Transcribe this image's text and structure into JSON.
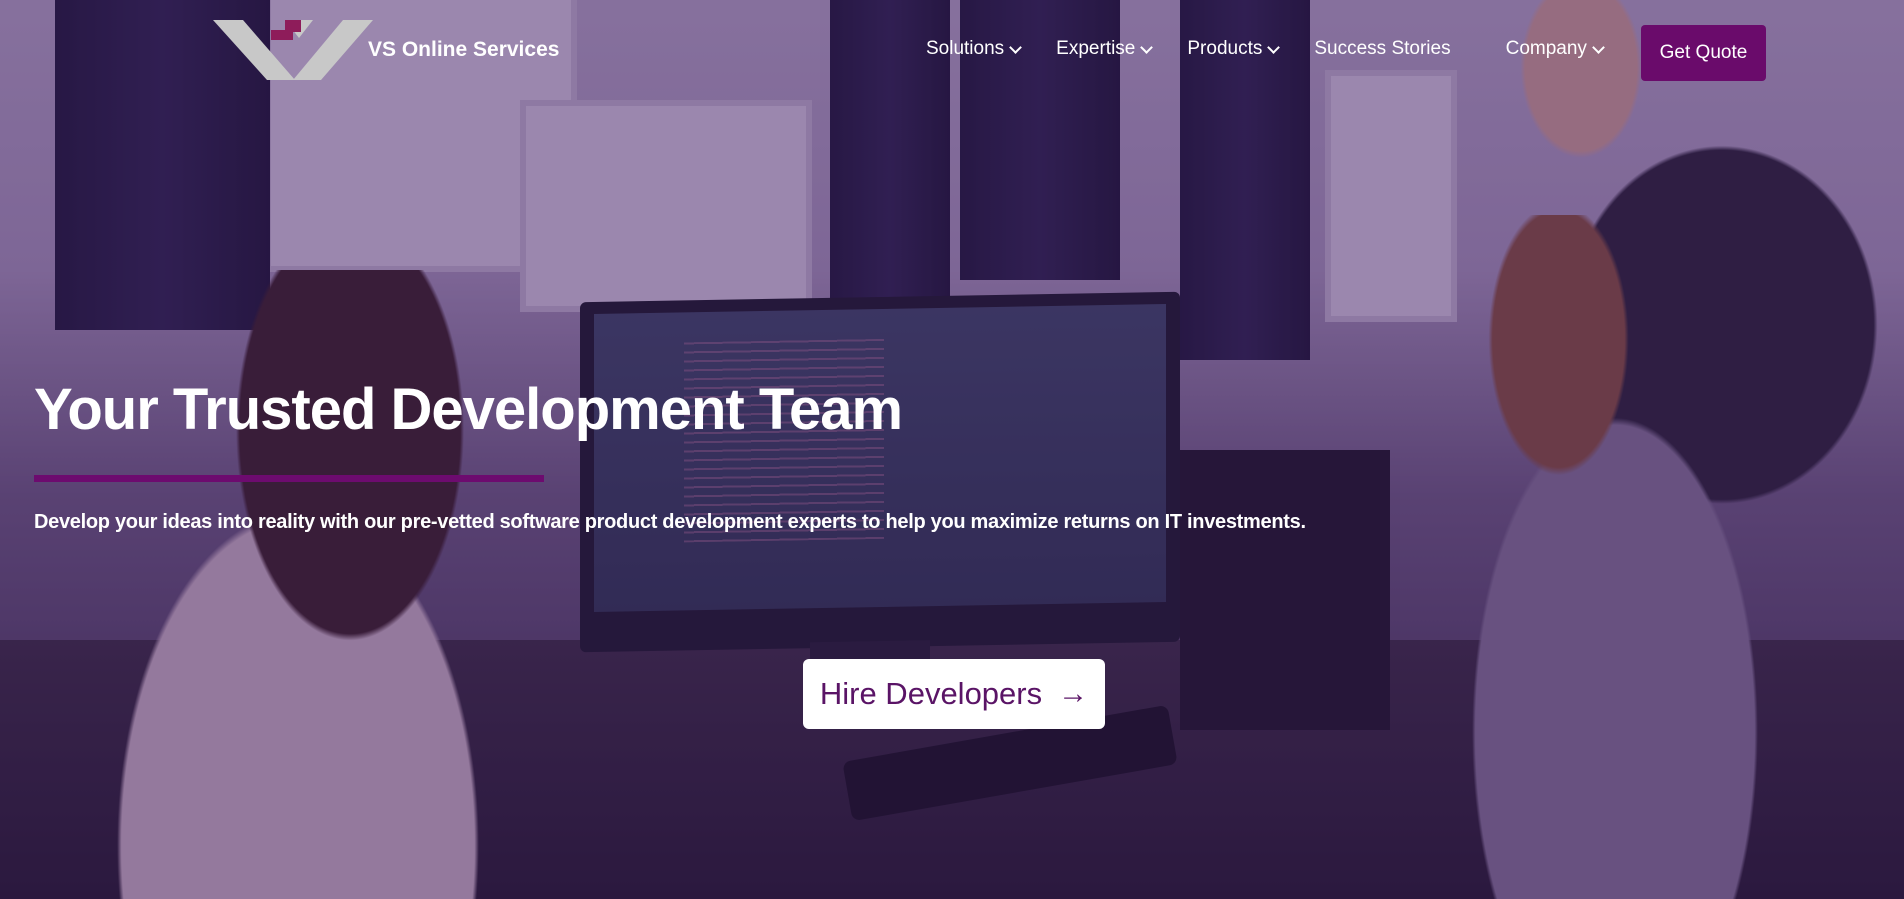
{
  "header": {
    "brand_name": "VS Online Services",
    "nav": [
      {
        "label": "Solutions",
        "has_dropdown": true
      },
      {
        "label": "Expertise",
        "has_dropdown": true
      },
      {
        "label": "Products",
        "has_dropdown": true
      },
      {
        "label": "Success Stories",
        "has_dropdown": false
      },
      {
        "label": "Company",
        "has_dropdown": true
      }
    ],
    "cta_label": "Get Quote"
  },
  "hero": {
    "title": "Your Trusted Development Team",
    "subtitle": "Develop your ideas into reality with our pre-vetted software product development experts to help you maximize returns on IT investments.",
    "button_label": "Hire Developers",
    "button_icon": "arrow-right-icon"
  },
  "colors": {
    "brand_purple": "#6a0b6b",
    "button_text": "#5a1466",
    "logo_gray": "#c8c8c8",
    "logo_accent": "#8e1c5a"
  }
}
